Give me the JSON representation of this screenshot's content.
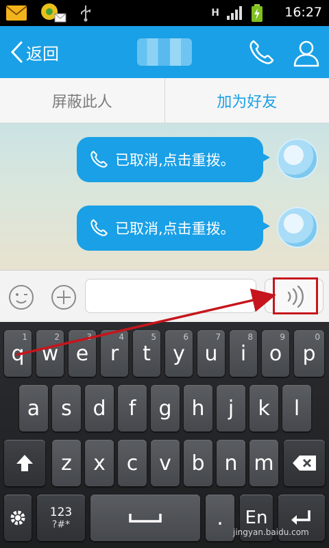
{
  "statusbar": {
    "time": "16:27",
    "network_label": "H",
    "icons": [
      "mail-icon",
      "app-icon",
      "usb-icon",
      "signal-icon",
      "battery-icon"
    ]
  },
  "titlebar": {
    "back_label": "返回",
    "icons": [
      "chevron-left-icon",
      "phone-icon",
      "person-icon"
    ]
  },
  "actionbar": {
    "block_label": "屏蔽此人",
    "add_friend_label": "加为好友"
  },
  "messages": [
    {
      "text": "已取消,点击重拨。",
      "icon": "phone-icon"
    },
    {
      "text": "已取消,点击重拨。",
      "icon": "phone-icon"
    }
  ],
  "inputbar": {
    "input_value": "",
    "icons": [
      "emoji-icon",
      "plus-icon",
      "voice-icon"
    ]
  },
  "keyboard": {
    "row1": [
      {
        "ch": "q",
        "sub": "1"
      },
      {
        "ch": "w",
        "sub": "2"
      },
      {
        "ch": "e",
        "sub": "3"
      },
      {
        "ch": "r",
        "sub": "4"
      },
      {
        "ch": "t",
        "sub": "5"
      },
      {
        "ch": "y",
        "sub": "6"
      },
      {
        "ch": "u",
        "sub": "7"
      },
      {
        "ch": "i",
        "sub": "8"
      },
      {
        "ch": "o",
        "sub": "9"
      },
      {
        "ch": "p",
        "sub": "0"
      }
    ],
    "row2": [
      "a",
      "s",
      "d",
      "f",
      "g",
      "h",
      "j",
      "k",
      "l"
    ],
    "row3": [
      "z",
      "x",
      "c",
      "v",
      "b",
      "n",
      "m"
    ],
    "symbols_label": "123",
    "symbols_sub": "?#*",
    "period_label": ".",
    "language_label": "En",
    "colors": {
      "accent": "#1aa0e6",
      "annotation": "#c6151c"
    }
  },
  "watermark": "jingyan.baidu.com"
}
